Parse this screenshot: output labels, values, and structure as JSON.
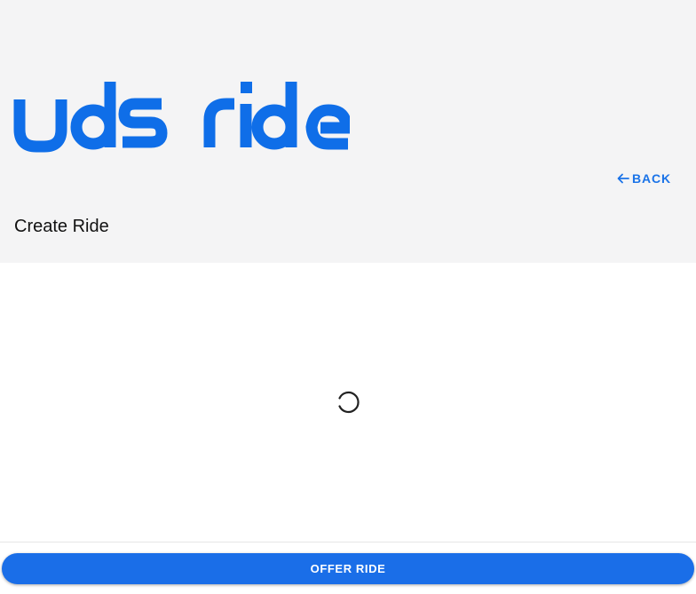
{
  "header": {
    "logo_text": "uds ride",
    "back_label": "BACK",
    "page_title": "Create Ride"
  },
  "main": {
    "loading": true
  },
  "footer": {
    "offer_label": "OFFER RIDE"
  },
  "colors": {
    "brand": "#0f6ee8",
    "header_bg": "#f4f4f5",
    "button_bg": "#1a6ee8"
  },
  "icons": {
    "back": "arrow-left-icon",
    "loading": "spinner-icon"
  }
}
